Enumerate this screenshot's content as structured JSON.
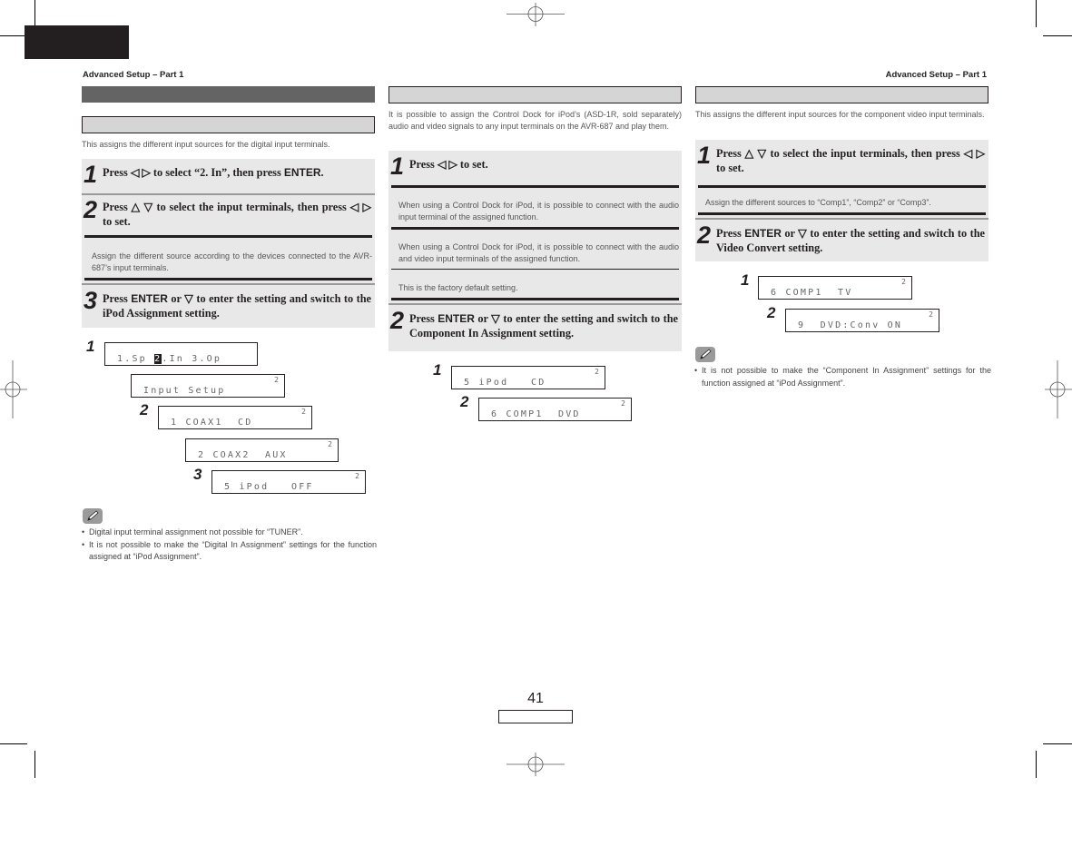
{
  "page": {
    "running_head_left": "Advanced Setup – Part 1",
    "running_head_right": "Advanced Setup – Part 1",
    "page_number": "41"
  },
  "colors": {
    "dark_bar": "#646464",
    "light_bar": "#d5d5d5",
    "step_bg": "#e8e8e8",
    "ink": "#231f20"
  },
  "col1": {
    "intro": "This assigns the different input sources for the digital input terminals.",
    "steps": [
      {
        "num": "1",
        "pre": "Press ◁ ▷ to select “2. In”, then press ",
        "enter": "ENTER",
        "post": "."
      },
      {
        "num": "2",
        "text": "Press △ ▽ to select the input terminals, then press ◁ ▷ to set.",
        "note": "Assign the different source according to the devices connected to the AVR-687’s input terminals."
      },
      {
        "num": "3",
        "pre": "Press ",
        "enter": "ENTER",
        "post": " or ▽ to enter the setting and switch to the iPod Assignment setting."
      }
    ],
    "displays": [
      {
        "label": "1",
        "pre": "1.Sp ",
        "hl": "2",
        "post": ".In 3.Op",
        "super": ""
      },
      {
        "label": "",
        "text": "Input Setup",
        "super": "2"
      },
      {
        "label": "2",
        "text": "1 COAX1  CD",
        "super": "2"
      },
      {
        "label": "",
        "text": "2 COAX2  AUX",
        "super": "2"
      },
      {
        "label": "3",
        "text": "5 iPod   OFF",
        "super": "2"
      }
    ],
    "notes": [
      "Digital input terminal assignment not possible for “TUNER”.",
      "It is not possible to make the “Digital In Assignment” settings for the function assigned at “iPod Assignment”."
    ]
  },
  "col2": {
    "intro": "It is possible to assign the Control Dock for iPod’s (ASD-1R, sold separately) audio and video signals to any input terminals on the AVR-687 and play them.",
    "steps": [
      {
        "num": "1",
        "text": "Press ◁ ▷ to set.",
        "options": [
          "When using a Control Dock for iPod, it is possible to connect with the audio input terminal of the assigned function.",
          "When using a Control Dock for iPod, it is possible to connect with the audio and video input terminals of the assigned function.",
          "This is the factory default setting."
        ]
      },
      {
        "num": "2",
        "pre": "Press ",
        "enter": "ENTER",
        "post": " or ▽ to enter the setting and switch to the Component In Assignment setting."
      }
    ],
    "displays": [
      {
        "label": "1",
        "text": "5 iPod   CD",
        "super": "2"
      },
      {
        "label": "2",
        "text": "6 COMP1  DVD",
        "super": "2"
      }
    ]
  },
  "col3": {
    "intro": "This assigns the different input sources for the component video input terminals.",
    "steps": [
      {
        "num": "1",
        "text": "Press △ ▽ to select the input terminals, then press ◁ ▷ to set.",
        "note": "Assign the different sources to “Comp1”, “Comp2” or “Comp3”."
      },
      {
        "num": "2",
        "pre": "Press ",
        "enter": "ENTER",
        "post": " or ▽ to enter the setting and switch to the Video Convert setting."
      }
    ],
    "displays": [
      {
        "label": "1",
        "text": "6 COMP1  TV",
        "super": "2"
      },
      {
        "label": "2",
        "text": "9  DVD:Conv ON",
        "super": "2"
      }
    ],
    "notes": [
      "It is not possible to make the “Component In Assignment” settings for the function assigned at “iPod Assignment”."
    ]
  },
  "icons": {
    "memo": "pencil-icon",
    "registration": "crosshair-icon"
  }
}
